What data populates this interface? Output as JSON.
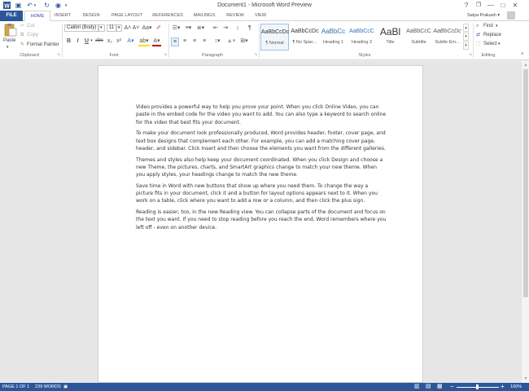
{
  "window": {
    "title": "Document1 - Microsoft Word Preview",
    "help": "?",
    "restore": "❐",
    "minimize": "—",
    "maximize": "□",
    "close": "✕"
  },
  "quick_access": {
    "save": "▣",
    "undo": "↶",
    "undo_arrow": "▾",
    "redo": "↻",
    "touch": "◉",
    "customize": "▾"
  },
  "tabs": [
    "FILE",
    "HOME",
    "INSERT",
    "DESIGN",
    "PAGE LAYOUT",
    "REFERENCES",
    "MAILINGS",
    "REVIEW",
    "VIEW"
  ],
  "user": {
    "name": "Satya Prakash ▾"
  },
  "ribbon": {
    "clipboard": {
      "label": "Clipboard",
      "paste": "Paste",
      "cut": "Cut",
      "copy": "Copy",
      "format_painter": "Format Painter",
      "cut_icon": "✂",
      "copy_icon": "⧉",
      "format_painter_icon": "✎",
      "launcher": "↘"
    },
    "font": {
      "label": "Font",
      "family": "Calibri (Body)",
      "size": "11",
      "bold": "B",
      "italic": "I",
      "underline": "U",
      "strikethrough": "abc",
      "subscript": "x₂",
      "superscript": "x²",
      "grow": "A˄",
      "shrink": "A˅",
      "change_case": "Aa▾",
      "clear": "✐",
      "effects": "A▾",
      "highlight": "ab▾",
      "color": "A▾",
      "launcher": "↘"
    },
    "paragraph": {
      "label": "Paragraph",
      "bullets": "☰▾",
      "numbering": "≡▾",
      "multilevel": "≣▾",
      "decrease_indent": "⇤",
      "increase_indent": "⇥",
      "sort": "↕",
      "pilcrow": "¶",
      "align_left": "≡",
      "center": "≡",
      "align_right": "≡",
      "justify": "≡",
      "line_spacing": "↕▾",
      "shading": "▲▾",
      "borders": "⊞▾",
      "launcher": "↘"
    },
    "styles": {
      "label": "Styles",
      "items": [
        {
          "preview": "AaBbCcDc",
          "name": "¶ Normal"
        },
        {
          "preview": "AaBbCcDc",
          "name": "¶ No Spac..."
        },
        {
          "preview": "AaBbCc",
          "name": "Heading 1"
        },
        {
          "preview": "AaBbCcC",
          "name": "Heading 2"
        },
        {
          "preview": "AaBl",
          "name": "Title"
        },
        {
          "preview": "AaBbCcC",
          "name": "Subtitle"
        },
        {
          "preview": "AaBbCcDc",
          "name": "Subtle Em..."
        }
      ],
      "scroll_up": "▴",
      "scroll_down": "▾",
      "more": "▾",
      "launcher": "↘"
    },
    "editing": {
      "label": "Editing",
      "find": "Find",
      "find_arrow": "▾",
      "replace": "Replace",
      "select": "Select",
      "select_arrow": "▾",
      "find_icon": "⌕",
      "replace_icon": "⇄",
      "select_icon": "⬚",
      "collapse": "˄"
    }
  },
  "document": {
    "paragraphs": [
      "Video provides a powerful way to help you prove your point. When you click Online Video, you can paste in the embed code for the video you want to add. You can also type a keyword to search online for the video that best fits your document.",
      "To make your document look professionally produced, Word provides header, footer, cover page, and text box designs that complement each other. For example, you can add a matching cover page, header, and sidebar. Click Insert and then choose the elements you want from the different galleries.",
      "Themes and styles also help keep your document coordinated. When you click Design and choose a new Theme, the pictures, charts, and SmartArt graphics change to match your new theme. When you apply styles, your headings change to match the new theme.",
      "Save time in Word with new buttons that show up where you need them. To change the way a picture fits in your document, click it and a button for layout options appears next to it. When you work on a table, click where you want to add a row or a column, and then click the plus sign.",
      "Reading is easier, too, in the new Reading view. You can collapse parts of the document and focus on the text you want. If you need to stop reading before you reach the end, Word remembers where you left off - even on another device."
    ]
  },
  "scrollbar": {
    "up": "▲",
    "down": "▼"
  },
  "status": {
    "page": "PAGE 1 OF 1",
    "words": "239 WORDS",
    "proof_icon": "▣",
    "read_mode": "▥",
    "print_layout": "▤",
    "web_layout": "▦",
    "zoom_out": "−",
    "zoom_in": "+",
    "zoom": "100%"
  },
  "colors": {
    "accent": "#2b579a"
  }
}
